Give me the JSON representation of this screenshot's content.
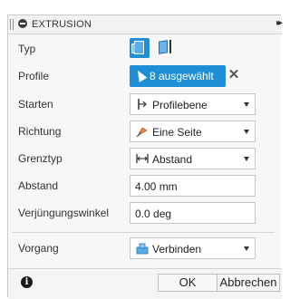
{
  "panel": {
    "title": "EXTRUSION",
    "expand_glyph": "▸▸"
  },
  "rows": {
    "typ": {
      "label": "Typ",
      "options": [
        "solid-extrude-icon",
        "surface-extrude-icon"
      ],
      "selected": "solid-extrude-icon"
    },
    "profile": {
      "label": "Profile",
      "value": "8 ausgewählt",
      "clear": "✕"
    },
    "starten": {
      "label": "Starten",
      "value": "Profilebene",
      "icon": "profile-plane-icon"
    },
    "richtung": {
      "label": "Richtung",
      "value": "Eine Seite",
      "icon": "one-side-direction-icon"
    },
    "grenztyp": {
      "label": "Grenztyp",
      "value": "Abstand",
      "icon": "distance-extent-icon"
    },
    "abstand": {
      "label": "Abstand",
      "value": "4.00 mm"
    },
    "verjuengungswinkel": {
      "label": "Verjüngungswinkel",
      "value": "0.0 deg"
    },
    "vorgang": {
      "label": "Vorgang",
      "value": "Verbinden",
      "icon": "join-operation-icon"
    }
  },
  "footer": {
    "info_glyph": "i",
    "ok_label": "OK",
    "cancel_label": "Abbrechen"
  },
  "colors": {
    "accent": "#1e8fd6",
    "panel_bg": "#f7f7f7",
    "border": "#c5c5c5"
  }
}
